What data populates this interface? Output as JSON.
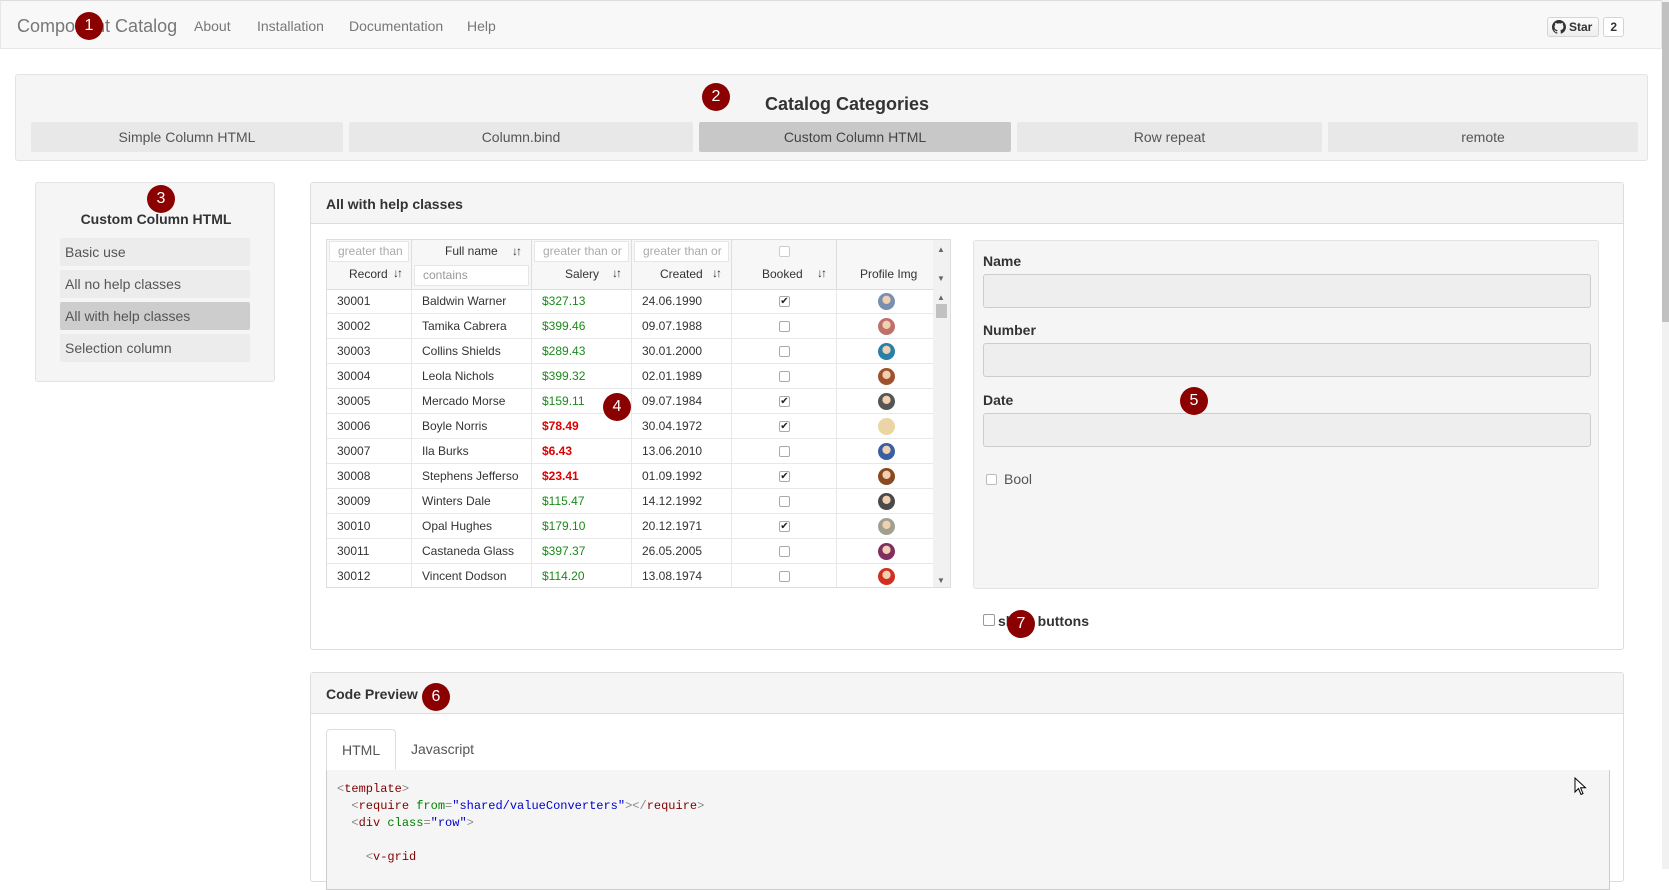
{
  "navbar": {
    "brand": "Component Catalog",
    "links": [
      "About",
      "Installation",
      "Documentation",
      "Help"
    ],
    "github": {
      "star_label": "Star",
      "star_count": "2"
    }
  },
  "markers": [
    "1",
    "2",
    "3",
    "4",
    "5",
    "6",
    "7"
  ],
  "categories": {
    "title": "Catalog Categories",
    "items": [
      "Simple Column HTML",
      "Column.bind",
      "Custom Column HTML",
      "Row repeat",
      "remote"
    ],
    "active": "Custom Column HTML"
  },
  "sidebar": {
    "title": "Custom Column HTML",
    "items": [
      "Basic use",
      "All no help classes",
      "All with help classes",
      "Selection column"
    ],
    "active": "All with help classes"
  },
  "panel": {
    "title": "All with help classes",
    "grid": {
      "filters": {
        "record": "greater than",
        "fullname": "contains",
        "salary": "greater than or",
        "created": "greater than or"
      },
      "headers": {
        "record": "Record",
        "fullname": "Full name",
        "salary": "Salery",
        "created": "Created",
        "booked": "Booked",
        "profile": "Profile Img"
      },
      "rows": [
        {
          "record": "30001",
          "name": "Baldwin Warner",
          "salary": "$327.13",
          "low": false,
          "created": "24.06.1990",
          "booked": true,
          "avatar": "#7a8fb0"
        },
        {
          "record": "30002",
          "name": "Tamika Cabrera",
          "salary": "$399.46",
          "low": false,
          "created": "09.07.1988",
          "booked": false,
          "avatar": "#c0706a"
        },
        {
          "record": "30003",
          "name": "Collins Shields",
          "salary": "$289.43",
          "low": false,
          "created": "30.01.2000",
          "booked": false,
          "avatar": "#2a7fa8"
        },
        {
          "record": "30004",
          "name": "Leola Nichols",
          "salary": "$399.32",
          "low": false,
          "created": "02.01.1989",
          "booked": false,
          "avatar": "#a0522d"
        },
        {
          "record": "30005",
          "name": "Mercado Morse",
          "salary": "$159.11",
          "low": false,
          "created": "09.07.1984",
          "booked": true,
          "avatar": "#555555"
        },
        {
          "record": "30006",
          "name": "Boyle Norris",
          "salary": "$78.49",
          "low": true,
          "created": "30.04.1972",
          "booked": true,
          "avatar": "#e8d8a0"
        },
        {
          "record": "30007",
          "name": "Ila Burks",
          "salary": "$6.43",
          "low": true,
          "created": "13.06.2010",
          "booked": false,
          "avatar": "#3a5fa0"
        },
        {
          "record": "30008",
          "name": "Stephens Jefferso",
          "salary": "$23.41",
          "low": true,
          "created": "01.09.1992",
          "booked": true,
          "avatar": "#8a4a20"
        },
        {
          "record": "30009",
          "name": "Winters Dale",
          "salary": "$115.47",
          "low": false,
          "created": "14.12.1992",
          "booked": false,
          "avatar": "#4a4a4a"
        },
        {
          "record": "30010",
          "name": "Opal Hughes",
          "salary": "$179.10",
          "low": false,
          "created": "20.12.1971",
          "booked": true,
          "avatar": "#a0a090"
        },
        {
          "record": "30011",
          "name": "Castaneda Glass",
          "salary": "$397.37",
          "low": false,
          "created": "26.05.2005",
          "booked": false,
          "avatar": "#803060"
        },
        {
          "record": "30012",
          "name": "Vincent Dodson",
          "salary": "$114.20",
          "low": false,
          "created": "13.08.1974",
          "booked": false,
          "avatar": "#d03020"
        }
      ]
    },
    "form": {
      "name_label": "Name",
      "number_label": "Number",
      "date_label": "Date",
      "bool_label": "Bool"
    },
    "show_buttons_label": "show buttons"
  },
  "code_preview": {
    "title": "Code Preview",
    "tabs": [
      "HTML",
      "Javascript"
    ],
    "active_tab": "HTML",
    "lines": {
      "l1_tag": "template",
      "l2_tag": "require",
      "l2_attr": "from",
      "l2_val": "\"shared/valueConverters\"",
      "l2_close": "require",
      "l3_tag": "div",
      "l3_attr": "class",
      "l3_val": "\"row\"",
      "l5_tag": "v-grid"
    }
  },
  "colors": {
    "marker": "#8b0000",
    "salary_ok": "#1a8a1a",
    "salary_low": "#e00000"
  }
}
